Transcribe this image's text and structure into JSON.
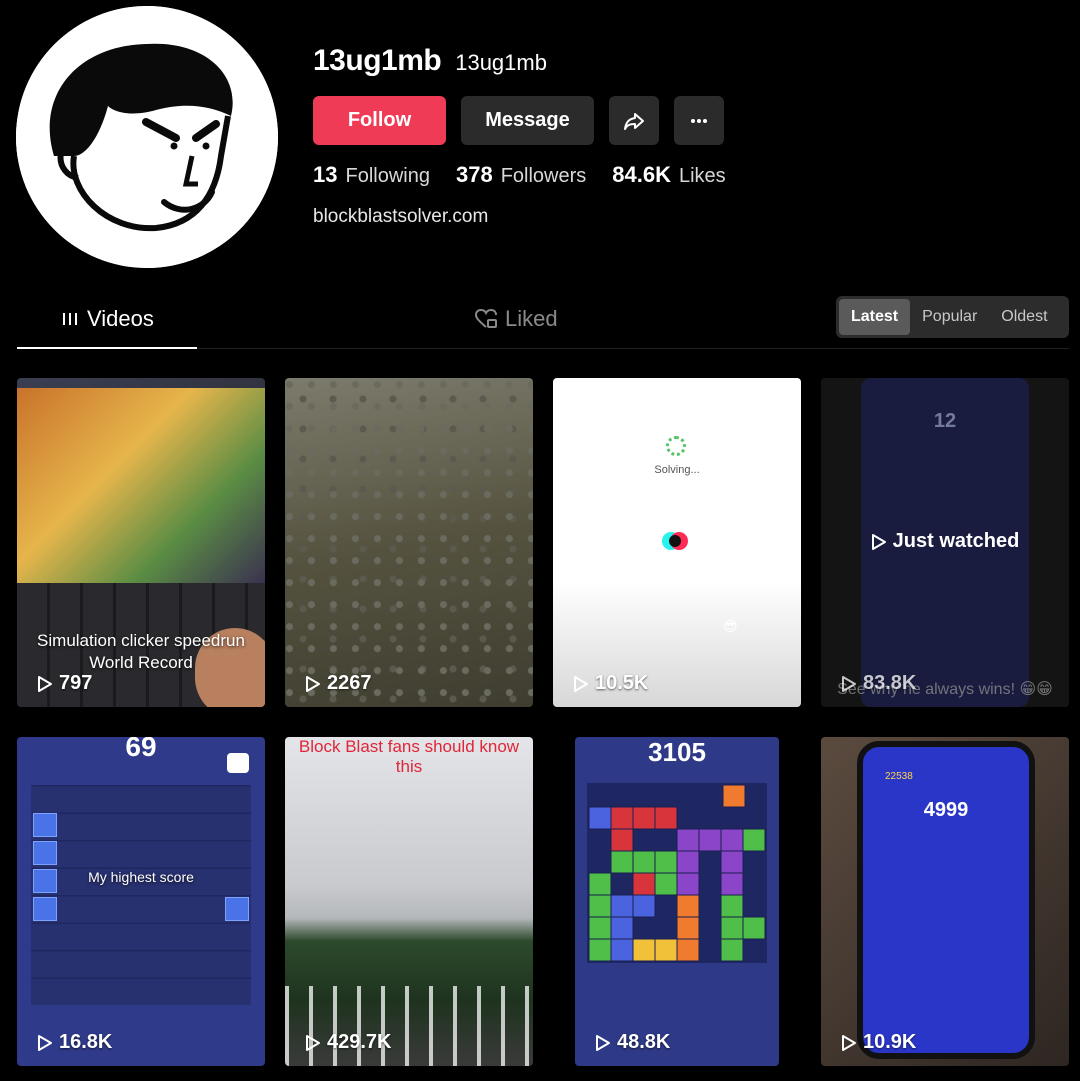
{
  "profile": {
    "username": "13ug1mb",
    "nickname": "13ug1mb",
    "bio_link": "blockblastsolver.com"
  },
  "actions": {
    "follow_label": "Follow",
    "message_label": "Message",
    "share_icon": "share-icon",
    "more_icon": "more-icon"
  },
  "stats": [
    {
      "value": "13",
      "label": "Following"
    },
    {
      "value": "378",
      "label": "Followers"
    },
    {
      "value": "84.6K",
      "label": "Likes"
    }
  ],
  "tabs": [
    {
      "label": "Videos",
      "icon": "grid-icon",
      "active": true
    },
    {
      "label": "Liked",
      "icon": "heart-lock-icon",
      "active": false
    }
  ],
  "sort": [
    {
      "label": "Latest",
      "active": true
    },
    {
      "label": "Popular",
      "active": false
    },
    {
      "label": "Oldest",
      "active": false
    }
  ],
  "videos": [
    {
      "views": "797",
      "caption": "Simulation clicker speedrun World Record"
    },
    {
      "views": "2267"
    },
    {
      "views": "10.5K",
      "overlay": "Solving..."
    },
    {
      "views": "83.8K",
      "badge": "Just watched",
      "caption": "See why he always wins! 😁😁",
      "score": "12"
    },
    {
      "views": "16.8K",
      "score": "69",
      "caption": "My highest score"
    },
    {
      "views": "429.7K",
      "caption": "Block Blast fans should know this"
    },
    {
      "views": "48.8K",
      "score": "3105"
    },
    {
      "views": "10.9K",
      "score": "4999",
      "crown": "22538"
    }
  ],
  "colors": {
    "follow": "#ef3b56",
    "button_dark": "#2b2b2b",
    "background": "#000000"
  }
}
